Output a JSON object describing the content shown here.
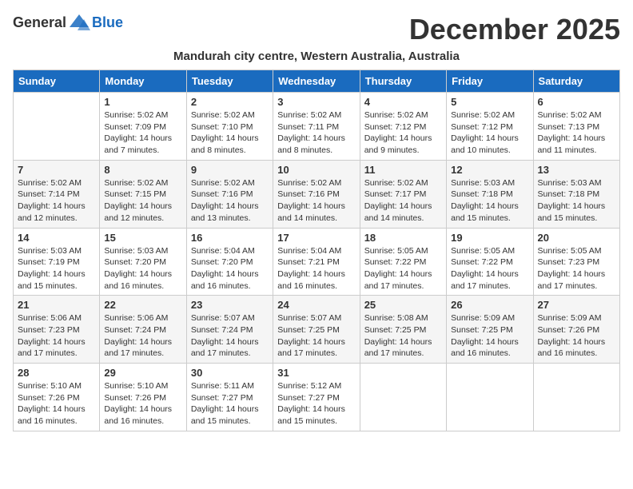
{
  "header": {
    "logo_general": "General",
    "logo_blue": "Blue",
    "month_title": "December 2025",
    "location": "Mandurah city centre, Western Australia, Australia"
  },
  "days_of_week": [
    "Sunday",
    "Monday",
    "Tuesday",
    "Wednesday",
    "Thursday",
    "Friday",
    "Saturday"
  ],
  "weeks": [
    [
      {
        "date": "",
        "info": ""
      },
      {
        "date": "1",
        "info": "Sunrise: 5:02 AM\nSunset: 7:09 PM\nDaylight: 14 hours\nand 7 minutes."
      },
      {
        "date": "2",
        "info": "Sunrise: 5:02 AM\nSunset: 7:10 PM\nDaylight: 14 hours\nand 8 minutes."
      },
      {
        "date": "3",
        "info": "Sunrise: 5:02 AM\nSunset: 7:11 PM\nDaylight: 14 hours\nand 8 minutes."
      },
      {
        "date": "4",
        "info": "Sunrise: 5:02 AM\nSunset: 7:12 PM\nDaylight: 14 hours\nand 9 minutes."
      },
      {
        "date": "5",
        "info": "Sunrise: 5:02 AM\nSunset: 7:12 PM\nDaylight: 14 hours\nand 10 minutes."
      },
      {
        "date": "6",
        "info": "Sunrise: 5:02 AM\nSunset: 7:13 PM\nDaylight: 14 hours\nand 11 minutes."
      }
    ],
    [
      {
        "date": "7",
        "info": "Sunrise: 5:02 AM\nSunset: 7:14 PM\nDaylight: 14 hours\nand 12 minutes."
      },
      {
        "date": "8",
        "info": "Sunrise: 5:02 AM\nSunset: 7:15 PM\nDaylight: 14 hours\nand 12 minutes."
      },
      {
        "date": "9",
        "info": "Sunrise: 5:02 AM\nSunset: 7:16 PM\nDaylight: 14 hours\nand 13 minutes."
      },
      {
        "date": "10",
        "info": "Sunrise: 5:02 AM\nSunset: 7:16 PM\nDaylight: 14 hours\nand 14 minutes."
      },
      {
        "date": "11",
        "info": "Sunrise: 5:02 AM\nSunset: 7:17 PM\nDaylight: 14 hours\nand 14 minutes."
      },
      {
        "date": "12",
        "info": "Sunrise: 5:03 AM\nSunset: 7:18 PM\nDaylight: 14 hours\nand 15 minutes."
      },
      {
        "date": "13",
        "info": "Sunrise: 5:03 AM\nSunset: 7:18 PM\nDaylight: 14 hours\nand 15 minutes."
      }
    ],
    [
      {
        "date": "14",
        "info": "Sunrise: 5:03 AM\nSunset: 7:19 PM\nDaylight: 14 hours\nand 15 minutes."
      },
      {
        "date": "15",
        "info": "Sunrise: 5:03 AM\nSunset: 7:20 PM\nDaylight: 14 hours\nand 16 minutes."
      },
      {
        "date": "16",
        "info": "Sunrise: 5:04 AM\nSunset: 7:20 PM\nDaylight: 14 hours\nand 16 minutes."
      },
      {
        "date": "17",
        "info": "Sunrise: 5:04 AM\nSunset: 7:21 PM\nDaylight: 14 hours\nand 16 minutes."
      },
      {
        "date": "18",
        "info": "Sunrise: 5:05 AM\nSunset: 7:22 PM\nDaylight: 14 hours\nand 17 minutes."
      },
      {
        "date": "19",
        "info": "Sunrise: 5:05 AM\nSunset: 7:22 PM\nDaylight: 14 hours\nand 17 minutes."
      },
      {
        "date": "20",
        "info": "Sunrise: 5:05 AM\nSunset: 7:23 PM\nDaylight: 14 hours\nand 17 minutes."
      }
    ],
    [
      {
        "date": "21",
        "info": "Sunrise: 5:06 AM\nSunset: 7:23 PM\nDaylight: 14 hours\nand 17 minutes."
      },
      {
        "date": "22",
        "info": "Sunrise: 5:06 AM\nSunset: 7:24 PM\nDaylight: 14 hours\nand 17 minutes."
      },
      {
        "date": "23",
        "info": "Sunrise: 5:07 AM\nSunset: 7:24 PM\nDaylight: 14 hours\nand 17 minutes."
      },
      {
        "date": "24",
        "info": "Sunrise: 5:07 AM\nSunset: 7:25 PM\nDaylight: 14 hours\nand 17 minutes."
      },
      {
        "date": "25",
        "info": "Sunrise: 5:08 AM\nSunset: 7:25 PM\nDaylight: 14 hours\nand 17 minutes."
      },
      {
        "date": "26",
        "info": "Sunrise: 5:09 AM\nSunset: 7:25 PM\nDaylight: 14 hours\nand 16 minutes."
      },
      {
        "date": "27",
        "info": "Sunrise: 5:09 AM\nSunset: 7:26 PM\nDaylight: 14 hours\nand 16 minutes."
      }
    ],
    [
      {
        "date": "28",
        "info": "Sunrise: 5:10 AM\nSunset: 7:26 PM\nDaylight: 14 hours\nand 16 minutes."
      },
      {
        "date": "29",
        "info": "Sunrise: 5:10 AM\nSunset: 7:26 PM\nDaylight: 14 hours\nand 16 minutes."
      },
      {
        "date": "30",
        "info": "Sunrise: 5:11 AM\nSunset: 7:27 PM\nDaylight: 14 hours\nand 15 minutes."
      },
      {
        "date": "31",
        "info": "Sunrise: 5:12 AM\nSunset: 7:27 PM\nDaylight: 14 hours\nand 15 minutes."
      },
      {
        "date": "",
        "info": ""
      },
      {
        "date": "",
        "info": ""
      },
      {
        "date": "",
        "info": ""
      }
    ]
  ]
}
